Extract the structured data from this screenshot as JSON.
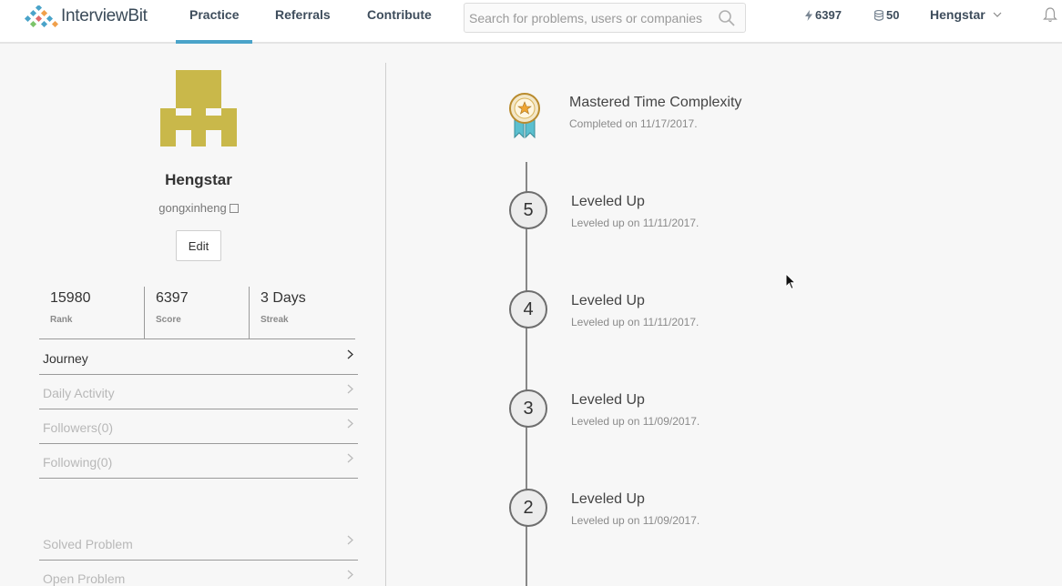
{
  "header": {
    "logo_text": "InterviewBit",
    "nav": [
      {
        "label": "Practice"
      },
      {
        "label": "Referrals"
      },
      {
        "label": "Contribute"
      }
    ],
    "search_placeholder": "Search for problems, users or companies",
    "score": "6397",
    "coins": "50",
    "username": "Hengstar"
  },
  "profile": {
    "name": "Hengstar",
    "handle": "gongxinheng",
    "edit_label": "Edit",
    "stats": [
      {
        "value": "15980",
        "label": "Rank"
      },
      {
        "value": "6397",
        "label": "Score"
      },
      {
        "value": "3 Days",
        "label": "Streak"
      }
    ],
    "menu": [
      {
        "label": "Journey"
      },
      {
        "label": "Daily Activity"
      },
      {
        "label": "Followers(0)"
      },
      {
        "label": "Following(0)"
      }
    ],
    "menu2": [
      {
        "label": "Solved Problem"
      },
      {
        "label": "Open Problem"
      }
    ]
  },
  "timeline": [
    {
      "title": "Mastered Time Complexity",
      "sub": "Completed on 11/17/2017."
    },
    {
      "level": "5",
      "title": "Leveled Up",
      "sub": "Leveled up on 11/11/2017."
    },
    {
      "level": "4",
      "title": "Leveled Up",
      "sub": "Leveled up on 11/11/2017."
    },
    {
      "level": "3",
      "title": "Leveled Up",
      "sub": "Leveled up on 11/09/2017."
    },
    {
      "level": "2",
      "title": "Leveled Up",
      "sub": "Leveled up on 11/09/2017."
    }
  ],
  "colors": {
    "accent": "#4aa3c9",
    "avatar": "#c9b84a"
  }
}
